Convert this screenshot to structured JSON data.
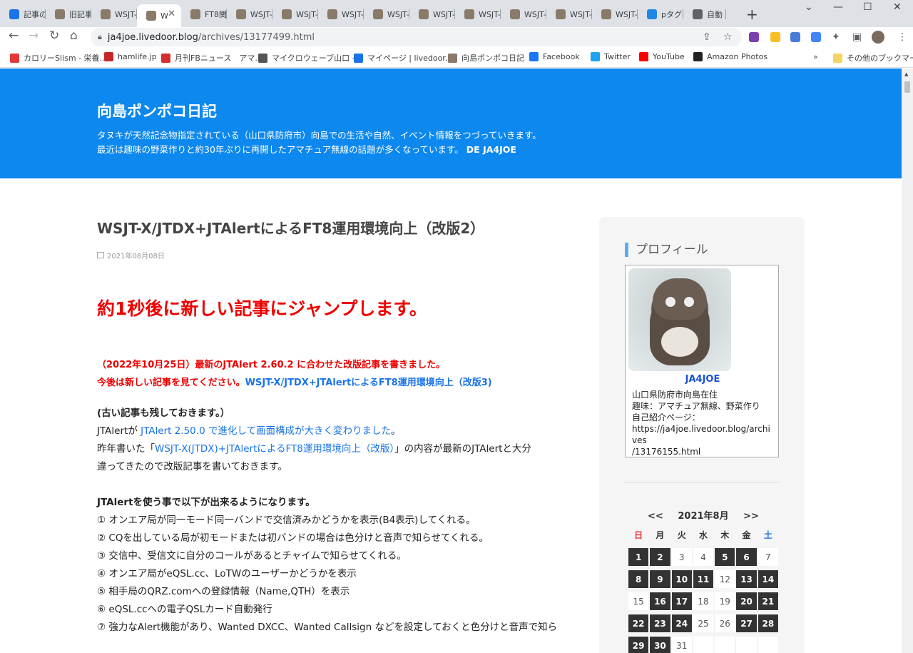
{
  "tabs": [
    {
      "label": "記事の",
      "fav": "#1a73e8"
    },
    {
      "label": "旧記事",
      "fav": "#8a7a6a"
    },
    {
      "label": "WSJT-",
      "fav": "#8a7a6a"
    },
    {
      "label": "W",
      "fav": "#8a7a6a"
    },
    {
      "label": "FT8関",
      "fav": "#8a7a6a"
    },
    {
      "label": "WSJT-",
      "fav": "#8a7a6a"
    },
    {
      "label": "WSJT-",
      "fav": "#8a7a6a"
    },
    {
      "label": "WSJT-",
      "fav": "#8a7a6a"
    },
    {
      "label": "WSJT-",
      "fav": "#8a7a6a"
    },
    {
      "label": "WSJT-",
      "fav": "#8a7a6a"
    },
    {
      "label": "WSJT-",
      "fav": "#8a7a6a"
    },
    {
      "label": "WSJT-",
      "fav": "#8a7a6a"
    },
    {
      "label": "WSJT-",
      "fav": "#8a7a6a"
    },
    {
      "label": "WSJT-",
      "fav": "#8a7a6a"
    },
    {
      "label": "pタグと",
      "fav": "#1e88e5"
    },
    {
      "label": "自動",
      "fav": "#5f6368"
    }
  ],
  "url": {
    "host": "ja4joe.livedoor.blog",
    "path": "/archives/13177499.html"
  },
  "bookmarks": [
    {
      "label": "カロリーSlism - 栄養...",
      "fav": "#e53935"
    },
    {
      "label": "hamlife.jp",
      "fav": "#c62828"
    },
    {
      "label": "月刊FBニュース　アマ...",
      "fav": "#d32f2f"
    },
    {
      "label": "マイクロウェーブ山口 -...",
      "fav": "#555555"
    },
    {
      "label": "マイページ | livedoor...",
      "fav": "#1a73e8"
    },
    {
      "label": "向島ポンポコ日記",
      "fav": "#8a7a6a"
    },
    {
      "label": "Facebook",
      "fav": "#1877f2"
    },
    {
      "label": "Twitter",
      "fav": "#1da1f2"
    },
    {
      "label": "YouTube",
      "fav": "#ff0000"
    },
    {
      "label": "Amazon Photos",
      "fav": "#222222"
    }
  ],
  "bookmarks_more": "»",
  "other_bookmarks": "その他のブックマーク",
  "blog": {
    "title": "向島ポンポコ日記",
    "desc1": "タヌキが天然記念物指定されている（山口県防府市）向島での生活や自然、イベント情報をつづっていきます。",
    "desc2": "最近は趣味の野菜作りと約30年ぶりに再開したアマチュア無線の話題が多くなっています。",
    "desc2_call": "DE JA4JOE"
  },
  "post": {
    "title": "WSJT-X/JTDX+JTAlertによるFT8運用環境向上（改版2）",
    "date": "2021年08月08日",
    "jump": "約1秒後に新しい記事にジャンプします。",
    "notice1": "（2022年10月25日）最新のJTAlert 2.60.2 に合わせた改版記事を書きました。",
    "notice2a": "今後は新しい記事を見てください。",
    "notice2_link": "WSJT-X/JTDX+JTAlertによるFT8運用環境向上（改版3)",
    "old_kept": "(古い記事も残しておきます。）",
    "p1a": "JTAlertが ",
    "p1_link": "JTAlert 2.50.0 で進化して画面構成が大きく変わりました",
    "p1b": "。",
    "p2a": "昨年書いた「",
    "p2_link": "WSJT-X(JTDX)+JTAlertによるFT8運用環境向上（改版）",
    "p2b": "」の内容が最新のJTAlertと大分",
    "p2c": "違ってきたので改版記事を書いておきます。",
    "list_head": "JTAlertを使う事で以下が出来るようになります。",
    "list": [
      "① オンエア局が同一モード同一バンドで交信済みかどうかを表示(B4表示)してくれる。",
      "② CQを出している局が初モードまたは初バンドの場合は色分けと音声で知らせてくれる。",
      "③ 交信中、受信文に自分のコールがあるとチャイムで知らせてくれる。",
      "④ オンエア局がeQSL.cc、LoTWのユーザーかどうかを表示",
      "⑤ 相手局のQRZ.comへの登録情報（Name,QTH）を表示",
      "⑥ eQSL.ccへの電子QSLカード自動発行",
      "⑦ 強力なAlert機能があり、Wanted DXCC、Wanted Callsign などを設定しておくと色分けと音声で知ら"
    ]
  },
  "sidebar": {
    "heading": "プロフィール",
    "name": "JA4JOE",
    "info1": "山口県防府市向島在住",
    "info2": "趣味：アマチュア無線、野菜作り",
    "info3": "自己紹介ページ：",
    "info4": "https://ja4joe.livedoor.blog/archives",
    "info5": "/13176155.html",
    "cal_prev": "<<",
    "cal_month": "2021年8月",
    "cal_next": ">>",
    "weekdays": [
      "日",
      "月",
      "火",
      "水",
      "木",
      "金",
      "土"
    ],
    "days": [
      [
        {
          "d": "1",
          "p": true
        },
        {
          "d": "2",
          "p": true
        },
        {
          "d": "3",
          "p": false
        },
        {
          "d": "4",
          "p": false
        },
        {
          "d": "5",
          "p": true
        },
        {
          "d": "6",
          "p": true
        },
        {
          "d": "7",
          "p": false
        }
      ],
      [
        {
          "d": "8",
          "p": true
        },
        {
          "d": "9",
          "p": true
        },
        {
          "d": "10",
          "p": true
        },
        {
          "d": "11",
          "p": true
        },
        {
          "d": "12",
          "p": false
        },
        {
          "d": "13",
          "p": true
        },
        {
          "d": "14",
          "p": true
        }
      ],
      [
        {
          "d": "15",
          "p": false
        },
        {
          "d": "16",
          "p": true
        },
        {
          "d": "17",
          "p": true
        },
        {
          "d": "18",
          "p": false
        },
        {
          "d": "19",
          "p": false
        },
        {
          "d": "20",
          "p": true
        },
        {
          "d": "21",
          "p": true
        }
      ],
      [
        {
          "d": "22",
          "p": true
        },
        {
          "d": "23",
          "p": true
        },
        {
          "d": "24",
          "p": true
        },
        {
          "d": "25",
          "p": false
        },
        {
          "d": "26",
          "p": false
        },
        {
          "d": "27",
          "p": true
        },
        {
          "d": "28",
          "p": true
        }
      ],
      [
        {
          "d": "29",
          "p": true
        },
        {
          "d": "30",
          "p": true
        },
        {
          "d": "31",
          "p": false
        },
        {
          "d": "",
          "p": false
        },
        {
          "d": "",
          "p": false
        },
        {
          "d": "",
          "p": false
        },
        {
          "d": "",
          "p": false
        }
      ]
    ]
  }
}
